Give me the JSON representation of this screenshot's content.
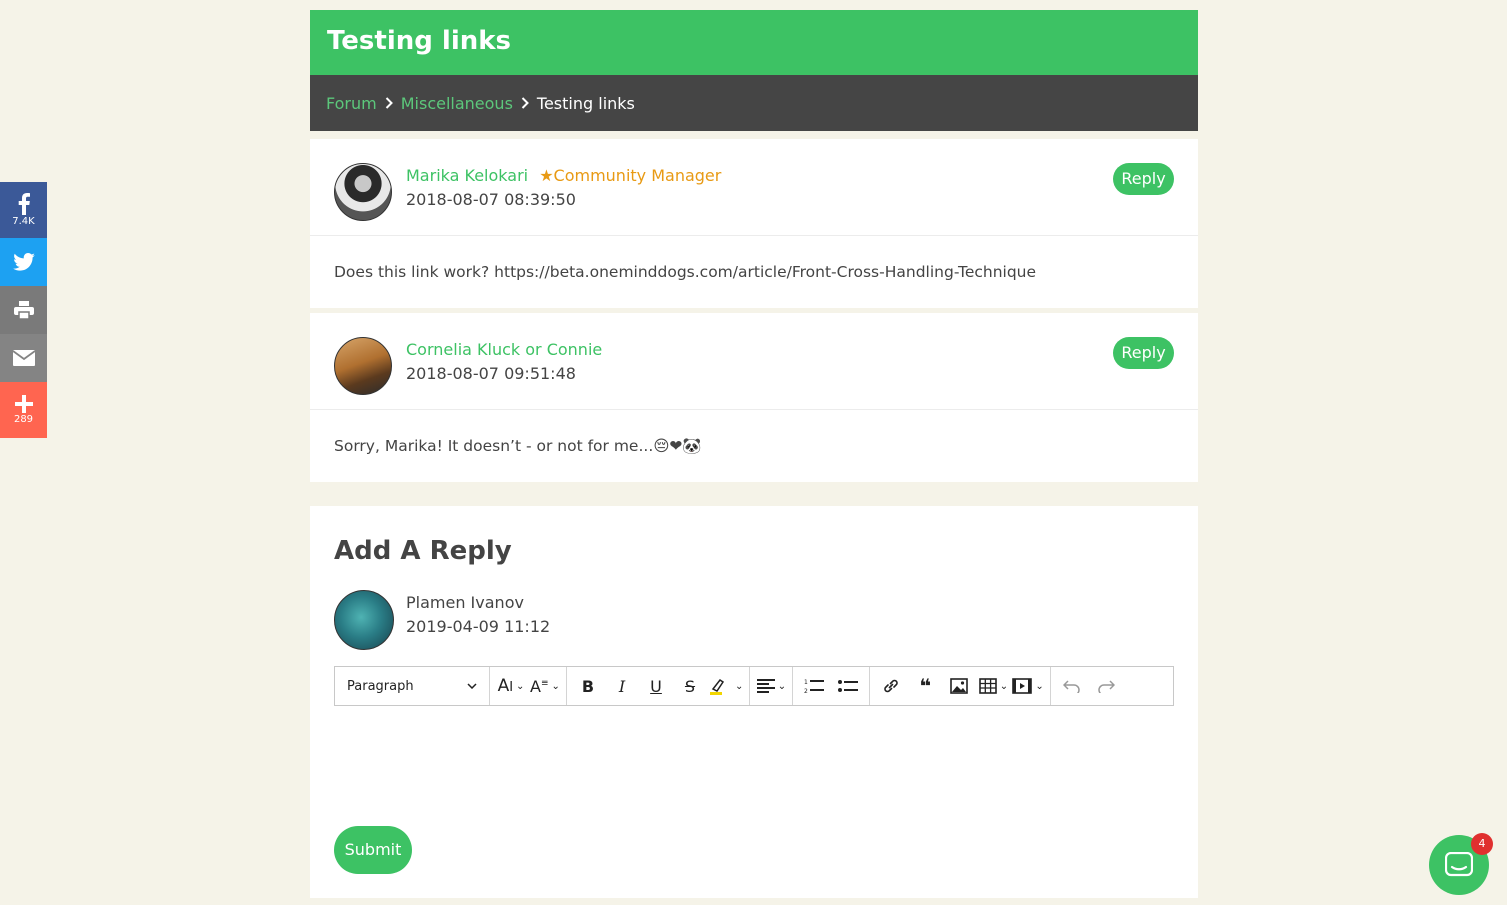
{
  "page": {
    "title": "Testing links"
  },
  "breadcrumb": {
    "forum": "Forum",
    "category": "Miscellaneous",
    "current": "Testing links"
  },
  "posts": [
    {
      "author": "Marika Kelokari",
      "badge": "Community Manager",
      "date": "2018-08-07 08:39:50",
      "reply_label": "Reply",
      "body": "Does this link work? https://beta.oneminddogs.com/article/Front-Cross-Handling-Technique"
    },
    {
      "author": "Cornelia Kluck or Connie",
      "date": "2018-08-07 09:51:48",
      "reply_label": "Reply",
      "body": "Sorry, Marika! It doesn’t - or not for me...😔❤🐼"
    }
  ],
  "reply_form": {
    "title": "Add A Reply",
    "user_name": "Plamen Ivanov",
    "user_date": "2019-04-09 11:12",
    "block_format": "Paragraph",
    "submit_label": "Submit"
  },
  "share": {
    "facebook_count": "7.4K",
    "more_count": "289"
  },
  "chat": {
    "badge_count": "4"
  },
  "colors": {
    "brand_green": "#3dc264",
    "badge_orange": "#e89a14",
    "breadcrumb_bg": "#454545"
  }
}
